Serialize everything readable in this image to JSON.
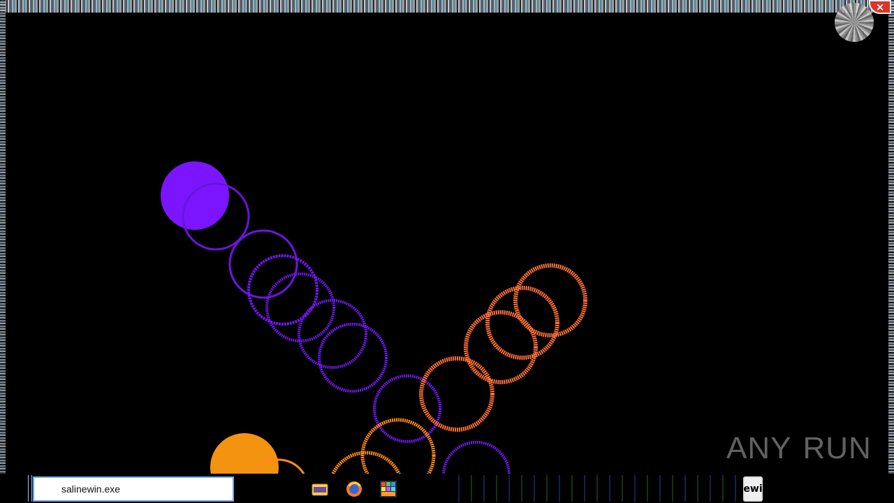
{
  "window": {
    "close_label": "×"
  },
  "taskbar": {
    "search_value": "salinewin.exe",
    "tray_label": "ewi",
    "icons": [
      "folder-icon",
      "firefox-icon",
      "colorful-app-icon"
    ]
  },
  "watermark": {
    "text_left": "ANY",
    "text_right": "RUN"
  },
  "colors": {
    "purple": "#7b15ff",
    "orange": "#ff8a1c",
    "orange_light": "#ff6f3a",
    "background": "#000000",
    "taskbar_border": "#6ea6e8"
  }
}
